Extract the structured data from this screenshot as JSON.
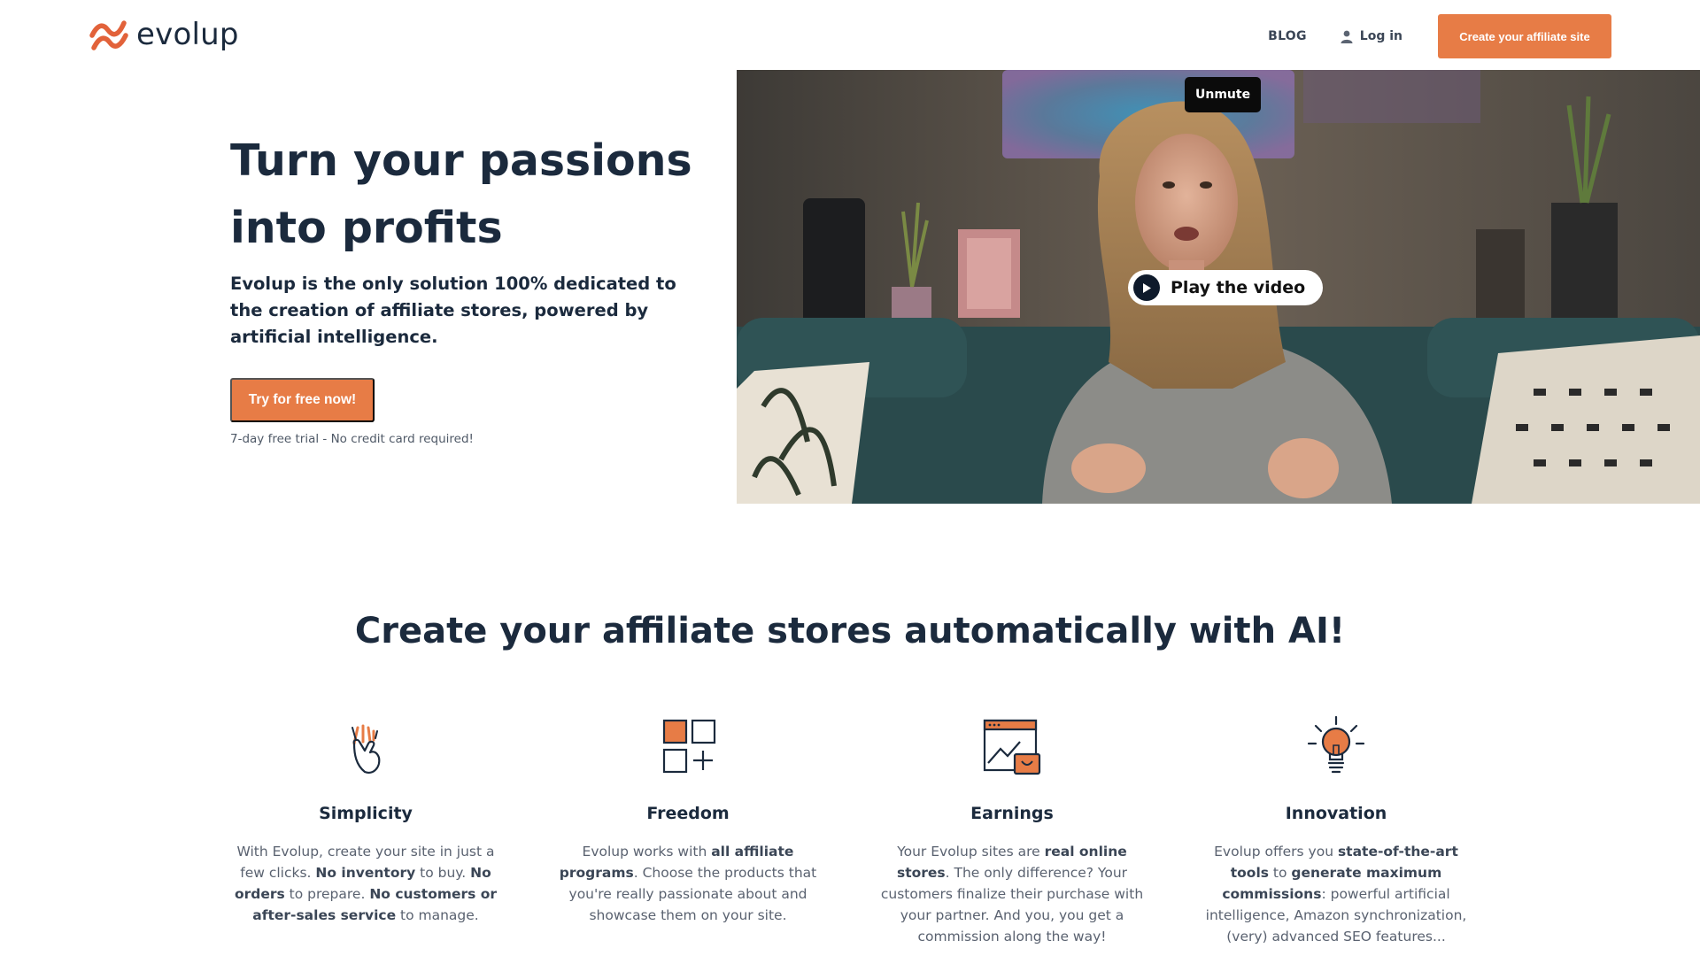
{
  "brand": {
    "name": "evolup",
    "accent": "#e77c46",
    "dark": "#1b2a3d"
  },
  "nav": {
    "blog": "BLOG",
    "login": "Log in",
    "cta": "Create your affiliate site"
  },
  "hero": {
    "title": "Turn your passions into profits",
    "subtitle": "Evolup is the only solution 100% dedicated to the creation of affiliate stores, powered by artificial intelligence.",
    "cta": "Try for free now!",
    "note": "7-day free trial - No credit card required!"
  },
  "video": {
    "unmute": "Unmute",
    "play": "Play the video"
  },
  "features": {
    "title": "Create your affiliate stores automatically with AI!",
    "items": [
      {
        "icon": "hand-snap-icon",
        "title": "Simplicity",
        "parts": [
          [
            "With Evolup, create your site in just a few clicks. ",
            false
          ],
          [
            "No inventory",
            true
          ],
          [
            " to buy. ",
            false
          ],
          [
            "No orders",
            true
          ],
          [
            " to prepare. ",
            false
          ],
          [
            "No customers or after-sales service",
            true
          ],
          [
            " to manage.",
            false
          ]
        ]
      },
      {
        "icon": "grid-plus-icon",
        "title": "Freedom",
        "parts": [
          [
            "Evolup works with ",
            false
          ],
          [
            "all affiliate programs",
            true
          ],
          [
            ". Choose the products that you're really passionate about and showcase them on your site.",
            false
          ]
        ]
      },
      {
        "icon": "store-chart-icon",
        "title": "Earnings",
        "parts": [
          [
            "Your Evolup sites are ",
            false
          ],
          [
            "real online stores",
            true
          ],
          [
            ". The only difference? Your customers finalize their purchase with your partner. And you, you get a commission along the way!",
            false
          ]
        ]
      },
      {
        "icon": "lightbulb-icon",
        "title": "Innovation",
        "parts": [
          [
            "Evolup offers you ",
            false
          ],
          [
            "state-of-the-art tools",
            true
          ],
          [
            " to ",
            false
          ],
          [
            "generate maximum commissions",
            true
          ],
          [
            ": powerful artificial intelligence, Amazon synchronization, (very) advanced SEO features...",
            false
          ]
        ]
      }
    ]
  }
}
